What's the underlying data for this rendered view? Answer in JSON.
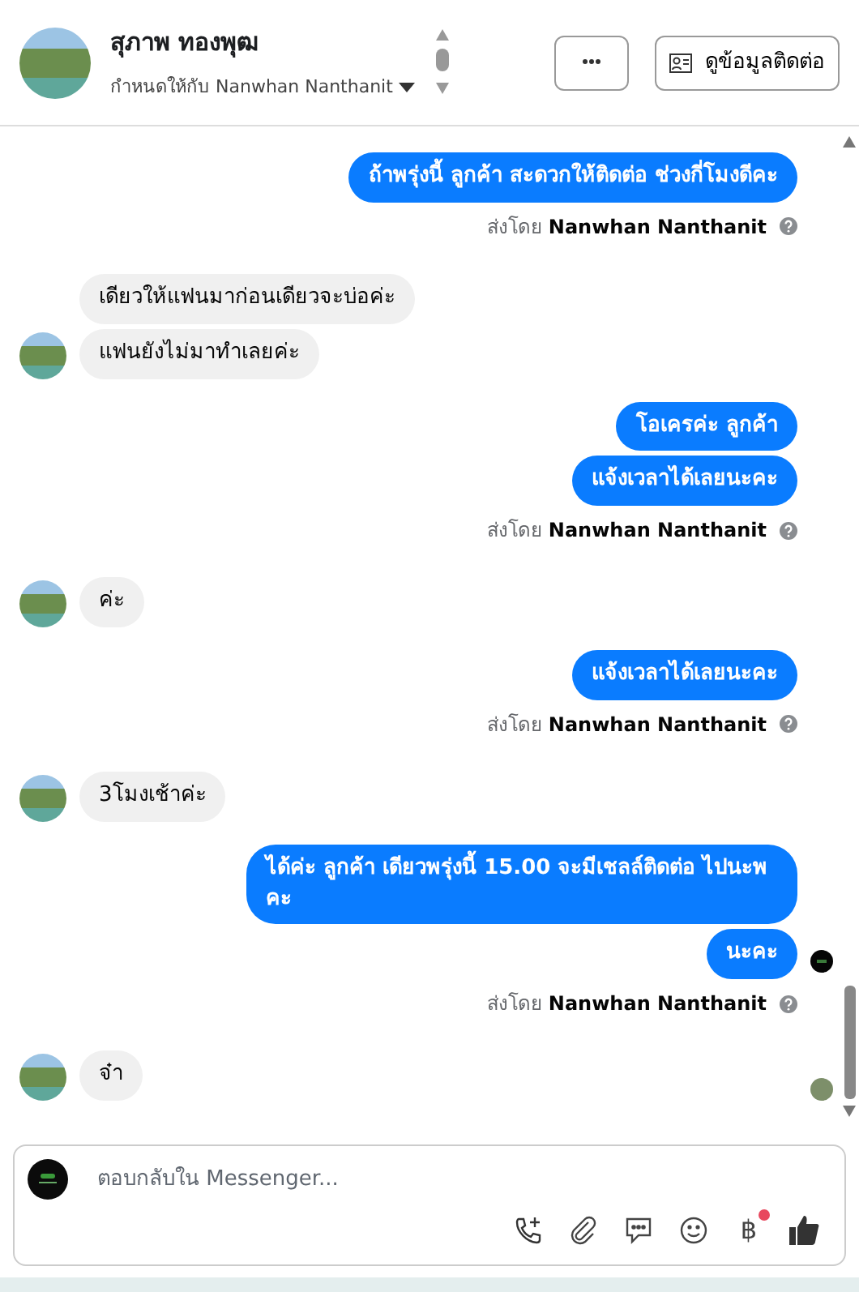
{
  "header": {
    "name": "สุภาพ ทองพุฒ",
    "assigned_label": "กำหนดให้กับ",
    "assignee": "Nanwhan Nanthanit",
    "contact_button": "ดูข้อมูลติดต่อ"
  },
  "messages": [
    {
      "kind": "out",
      "text": "ถ้าพรุ่งนี้ ลูกค้า สะดวกให้ติดต่อ ช่วงกี่โมงดีคะ"
    },
    {
      "kind": "sent_by",
      "label": "ส่งโดย",
      "sender": "Nanwhan Nanthanit"
    },
    {
      "kind": "in",
      "text": "เดียวให้แฟนมาก่อนเดียวจะบ่อค่ะ",
      "avatar": false
    },
    {
      "kind": "in",
      "text": "แฟนยังไม่มาทำเลยค่ะ",
      "avatar": true
    },
    {
      "kind": "out",
      "text": "โอเครค่ะ ลูกค้า"
    },
    {
      "kind": "out",
      "text": "แจ้งเวลาได้เลยนะคะ"
    },
    {
      "kind": "sent_by",
      "label": "ส่งโดย",
      "sender": "Nanwhan Nanthanit"
    },
    {
      "kind": "in",
      "text": "ค่ะ",
      "avatar": true
    },
    {
      "kind": "out",
      "text": "แจ้งเวลาได้เลยนะคะ"
    },
    {
      "kind": "sent_by",
      "label": "ส่งโดย",
      "sender": "Nanwhan Nanthanit"
    },
    {
      "kind": "in",
      "text": "3โมงเช้าค่ะ",
      "avatar": true
    },
    {
      "kind": "out",
      "text": "ได้ค่ะ ลูกค้า เดียวพรุ่งนี้ 15.00 จะมีเชลล์ติดต่อ ไปนะพ คะ"
    },
    {
      "kind": "out",
      "text": "นะคะ",
      "receipt": true
    },
    {
      "kind": "sent_by",
      "label": "ส่งโดย",
      "sender": "Nanwhan Nanthanit"
    },
    {
      "kind": "in",
      "text": "จ๋า",
      "avatar": true,
      "receipt": true
    }
  ],
  "composer": {
    "placeholder": "ตอบกลับใน Messenger...",
    "currency_symbol": "฿",
    "currency_notification": true
  }
}
